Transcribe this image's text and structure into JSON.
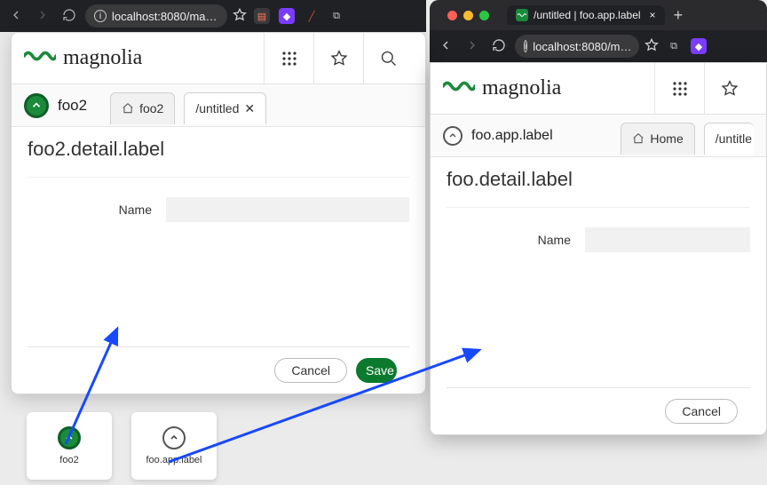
{
  "browser": {
    "left": {
      "url_display": "localhost:8080/ma…"
    },
    "right": {
      "tab_title": "/untitled | foo.app.label",
      "url_display": "localhost:8080/m…"
    }
  },
  "left_app": {
    "brand": "magnolia",
    "subapp_title": "foo2",
    "tab_browse": "foo2",
    "tab_detail": "/untitled",
    "page_title": "foo2.detail.label",
    "field_name_label": "Name",
    "field_name_value": "",
    "cancel_label": "Cancel",
    "save_label": "Save"
  },
  "right_app": {
    "brand": "magnolia",
    "subapp_title": "foo.app.label",
    "tab_browse": "Home",
    "tab_detail": "/untitle",
    "page_title": "foo.detail.label",
    "field_name_label": "Name",
    "field_name_value": "",
    "cancel_label": "Cancel"
  },
  "tiles": {
    "tile1_label": "foo2",
    "tile2_label": "foo.app.label"
  }
}
